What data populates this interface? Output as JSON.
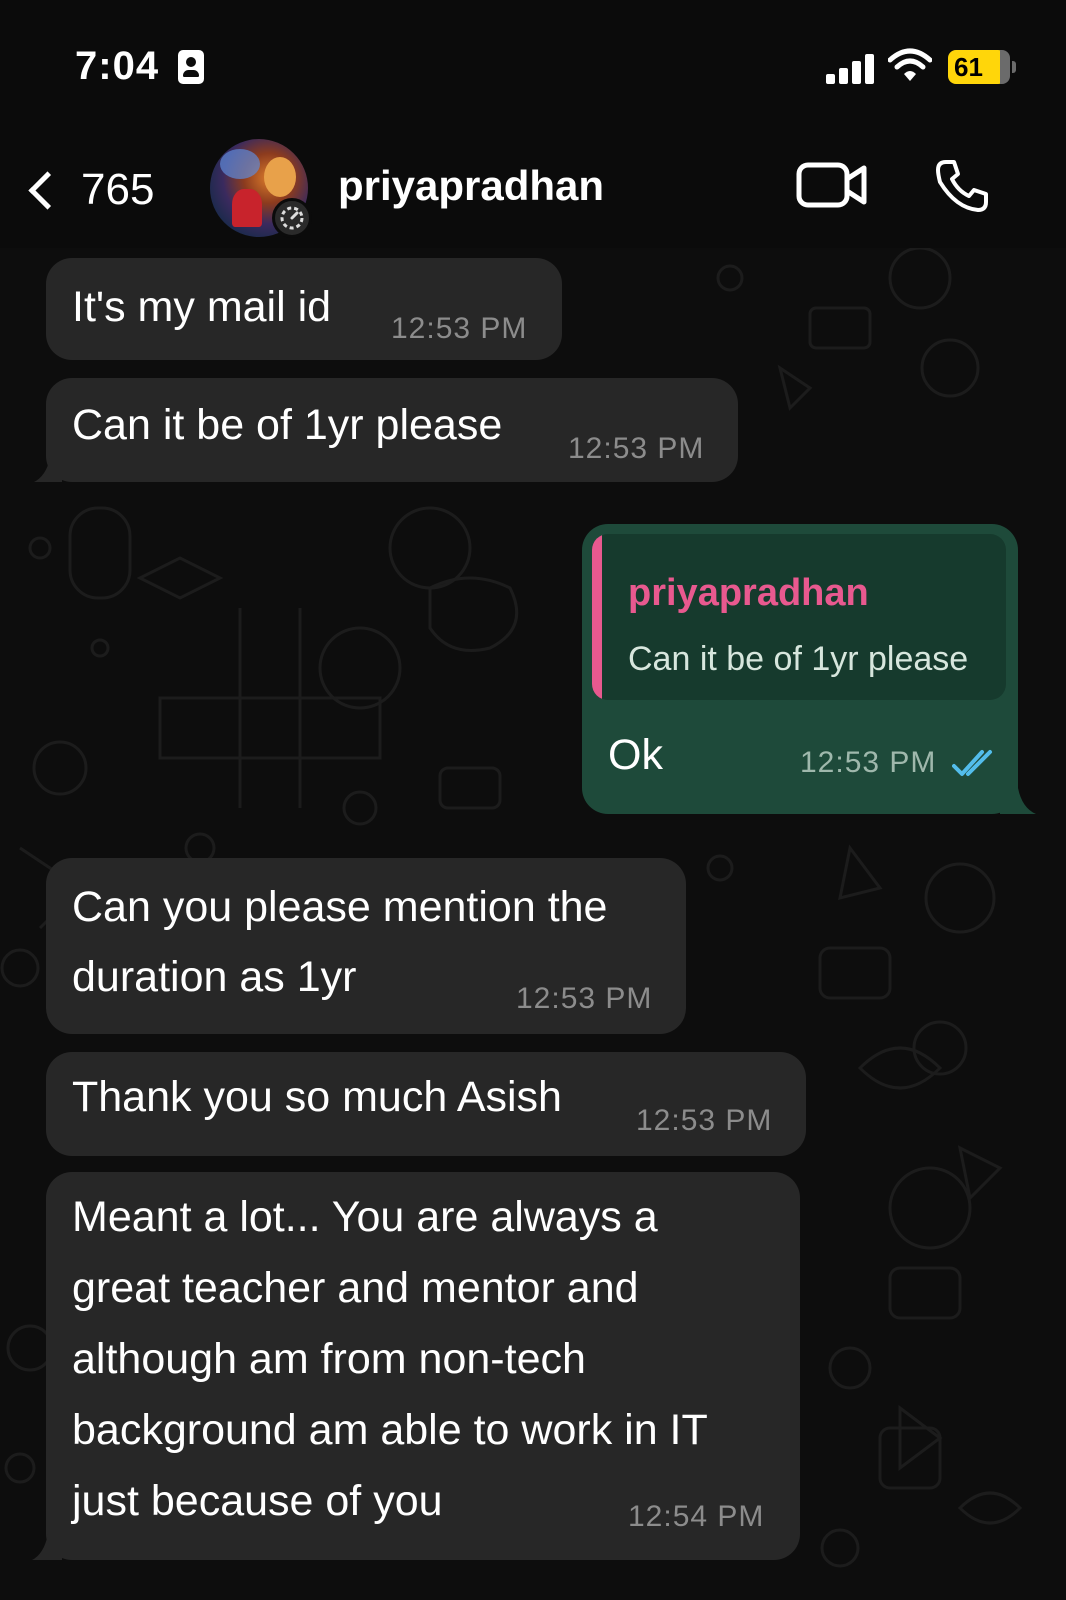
{
  "status_bar": {
    "time": "7:04",
    "battery_level": "61"
  },
  "header": {
    "back_count": "765",
    "contact_name": "priyapradhan"
  },
  "messages": [
    {
      "direction": "incoming",
      "lines": [
        "It's my mail id"
      ],
      "time": "12:53 PM"
    },
    {
      "direction": "incoming",
      "lines": [
        "Can it be of 1yr please"
      ],
      "time": "12:53 PM"
    },
    {
      "direction": "outgoing",
      "quote_author": "priyapradhan",
      "quote_text": "Can it be of 1yr please",
      "lines": [
        "Ok"
      ],
      "time": "12:53 PM",
      "status": "read"
    },
    {
      "direction": "incoming",
      "lines": [
        "Can you please mention the",
        "duration as 1yr"
      ],
      "time": "12:53 PM"
    },
    {
      "direction": "incoming",
      "lines": [
        "Thank you so much Asish"
      ],
      "time": "12:53 PM"
    },
    {
      "direction": "incoming",
      "lines": [
        "Meant a lot... You are always a",
        "great teacher and mentor and",
        "although am from non-tech",
        "background am able to work in IT",
        "just because of you"
      ],
      "time": "12:54 PM"
    }
  ],
  "colors": {
    "background": "#0b0b0b",
    "incoming_bubble": "#272727",
    "outgoing_bubble": "#1e4a3a",
    "quote_accent": "#e8598f",
    "read_receipt": "#53bdeb",
    "battery": "#ffd60a"
  }
}
